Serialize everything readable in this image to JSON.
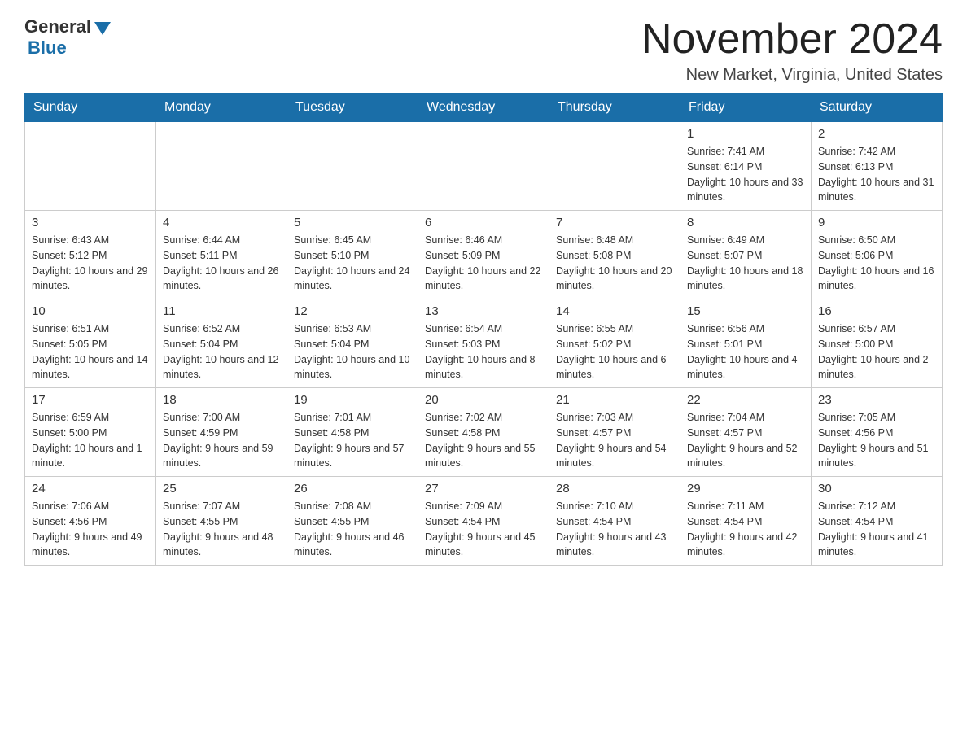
{
  "logo": {
    "general": "General",
    "blue": "Blue"
  },
  "title": "November 2024",
  "location": "New Market, Virginia, United States",
  "weekdays": [
    "Sunday",
    "Monday",
    "Tuesday",
    "Wednesday",
    "Thursday",
    "Friday",
    "Saturday"
  ],
  "weeks": [
    [
      {
        "day": "",
        "info": ""
      },
      {
        "day": "",
        "info": ""
      },
      {
        "day": "",
        "info": ""
      },
      {
        "day": "",
        "info": ""
      },
      {
        "day": "",
        "info": ""
      },
      {
        "day": "1",
        "info": "Sunrise: 7:41 AM\nSunset: 6:14 PM\nDaylight: 10 hours and 33 minutes."
      },
      {
        "day": "2",
        "info": "Sunrise: 7:42 AM\nSunset: 6:13 PM\nDaylight: 10 hours and 31 minutes."
      }
    ],
    [
      {
        "day": "3",
        "info": "Sunrise: 6:43 AM\nSunset: 5:12 PM\nDaylight: 10 hours and 29 minutes."
      },
      {
        "day": "4",
        "info": "Sunrise: 6:44 AM\nSunset: 5:11 PM\nDaylight: 10 hours and 26 minutes."
      },
      {
        "day": "5",
        "info": "Sunrise: 6:45 AM\nSunset: 5:10 PM\nDaylight: 10 hours and 24 minutes."
      },
      {
        "day": "6",
        "info": "Sunrise: 6:46 AM\nSunset: 5:09 PM\nDaylight: 10 hours and 22 minutes."
      },
      {
        "day": "7",
        "info": "Sunrise: 6:48 AM\nSunset: 5:08 PM\nDaylight: 10 hours and 20 minutes."
      },
      {
        "day": "8",
        "info": "Sunrise: 6:49 AM\nSunset: 5:07 PM\nDaylight: 10 hours and 18 minutes."
      },
      {
        "day": "9",
        "info": "Sunrise: 6:50 AM\nSunset: 5:06 PM\nDaylight: 10 hours and 16 minutes."
      }
    ],
    [
      {
        "day": "10",
        "info": "Sunrise: 6:51 AM\nSunset: 5:05 PM\nDaylight: 10 hours and 14 minutes."
      },
      {
        "day": "11",
        "info": "Sunrise: 6:52 AM\nSunset: 5:04 PM\nDaylight: 10 hours and 12 minutes."
      },
      {
        "day": "12",
        "info": "Sunrise: 6:53 AM\nSunset: 5:04 PM\nDaylight: 10 hours and 10 minutes."
      },
      {
        "day": "13",
        "info": "Sunrise: 6:54 AM\nSunset: 5:03 PM\nDaylight: 10 hours and 8 minutes."
      },
      {
        "day": "14",
        "info": "Sunrise: 6:55 AM\nSunset: 5:02 PM\nDaylight: 10 hours and 6 minutes."
      },
      {
        "day": "15",
        "info": "Sunrise: 6:56 AM\nSunset: 5:01 PM\nDaylight: 10 hours and 4 minutes."
      },
      {
        "day": "16",
        "info": "Sunrise: 6:57 AM\nSunset: 5:00 PM\nDaylight: 10 hours and 2 minutes."
      }
    ],
    [
      {
        "day": "17",
        "info": "Sunrise: 6:59 AM\nSunset: 5:00 PM\nDaylight: 10 hours and 1 minute."
      },
      {
        "day": "18",
        "info": "Sunrise: 7:00 AM\nSunset: 4:59 PM\nDaylight: 9 hours and 59 minutes."
      },
      {
        "day": "19",
        "info": "Sunrise: 7:01 AM\nSunset: 4:58 PM\nDaylight: 9 hours and 57 minutes."
      },
      {
        "day": "20",
        "info": "Sunrise: 7:02 AM\nSunset: 4:58 PM\nDaylight: 9 hours and 55 minutes."
      },
      {
        "day": "21",
        "info": "Sunrise: 7:03 AM\nSunset: 4:57 PM\nDaylight: 9 hours and 54 minutes."
      },
      {
        "day": "22",
        "info": "Sunrise: 7:04 AM\nSunset: 4:57 PM\nDaylight: 9 hours and 52 minutes."
      },
      {
        "day": "23",
        "info": "Sunrise: 7:05 AM\nSunset: 4:56 PM\nDaylight: 9 hours and 51 minutes."
      }
    ],
    [
      {
        "day": "24",
        "info": "Sunrise: 7:06 AM\nSunset: 4:56 PM\nDaylight: 9 hours and 49 minutes."
      },
      {
        "day": "25",
        "info": "Sunrise: 7:07 AM\nSunset: 4:55 PM\nDaylight: 9 hours and 48 minutes."
      },
      {
        "day": "26",
        "info": "Sunrise: 7:08 AM\nSunset: 4:55 PM\nDaylight: 9 hours and 46 minutes."
      },
      {
        "day": "27",
        "info": "Sunrise: 7:09 AM\nSunset: 4:54 PM\nDaylight: 9 hours and 45 minutes."
      },
      {
        "day": "28",
        "info": "Sunrise: 7:10 AM\nSunset: 4:54 PM\nDaylight: 9 hours and 43 minutes."
      },
      {
        "day": "29",
        "info": "Sunrise: 7:11 AM\nSunset: 4:54 PM\nDaylight: 9 hours and 42 minutes."
      },
      {
        "day": "30",
        "info": "Sunrise: 7:12 AM\nSunset: 4:54 PM\nDaylight: 9 hours and 41 minutes."
      }
    ]
  ]
}
